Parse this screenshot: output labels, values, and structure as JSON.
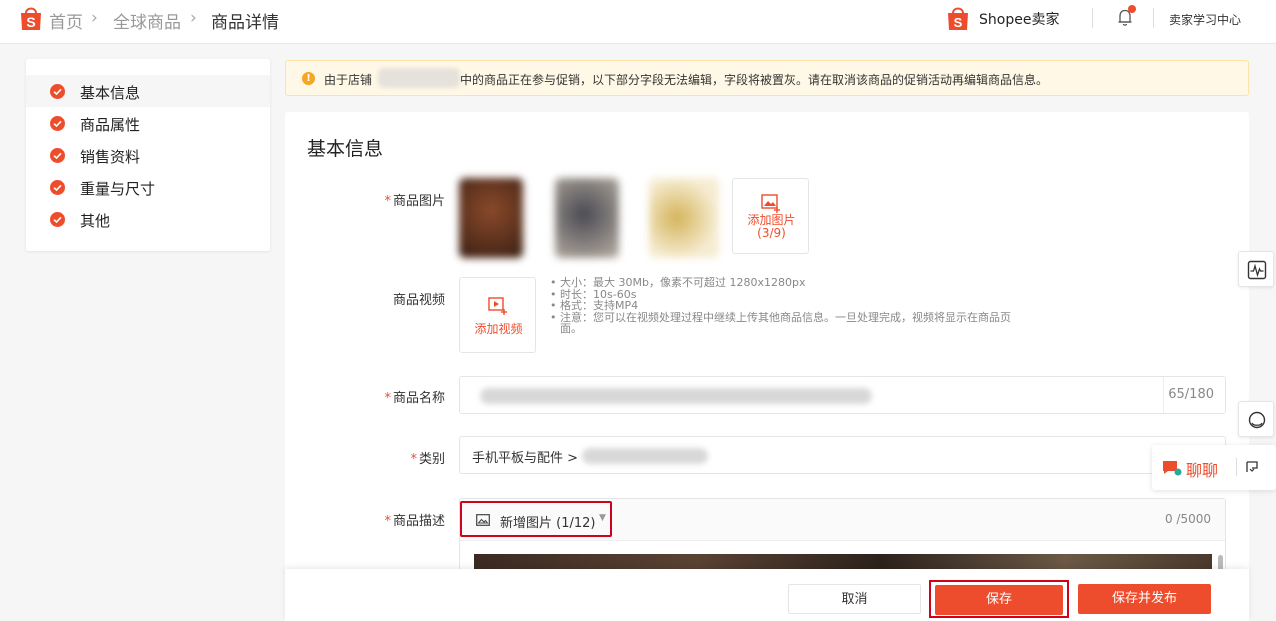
{
  "breadcrumb": {
    "home": "首页",
    "global_products": "全球商品",
    "current": "商品详情"
  },
  "header": {
    "brand": "Shopee卖家",
    "learning_center": "卖家学习中心",
    "icons": [
      "shopee-bag-icon",
      "bell-icon"
    ]
  },
  "sidebar": {
    "items": [
      {
        "label": "基本信息",
        "active": true
      },
      {
        "label": "商品属性"
      },
      {
        "label": "销售资料"
      },
      {
        "label": "重量与尺寸"
      },
      {
        "label": "其他"
      }
    ]
  },
  "notice": {
    "prefix": "由于店铺",
    "suffix": "中的商品正在参与促销，以下部分字段无法编辑，字段将被置灰。请在取消该商品的促销活动再编辑商品信息。"
  },
  "form": {
    "section_title": "基本信息",
    "images_label": "商品图片",
    "add_image_label": "添加图片",
    "add_image_count": "(3/9)",
    "video_label": "商品视频",
    "add_video_label": "添加视频",
    "video_notes": [
      "大小：最大 30Mb，像素不可超过 1280x1280px",
      "时长：10s-60s",
      "格式：支持MP4",
      "注意：您可以在视频处理过程中继续上传其他商品信息。一旦处理完成，视频将显示在商品页面。"
    ],
    "name_label": "商品名称",
    "name_counter": "65/180",
    "category_label": "类别",
    "category_value": "手机平板与配件 >",
    "description_label": "商品描述",
    "add_picture_button": "新增图片 (1/12)",
    "description_counter": "0 /5000",
    "required_mark": "*"
  },
  "actions": {
    "cancel": "取消",
    "save": "保存",
    "save_publish": "保存并发布"
  },
  "chat": {
    "label": "聊聊"
  },
  "colors": {
    "accent": "#ee4d2d",
    "highlight_border": "#d0011b",
    "notice_bg": "#fff8e6"
  }
}
